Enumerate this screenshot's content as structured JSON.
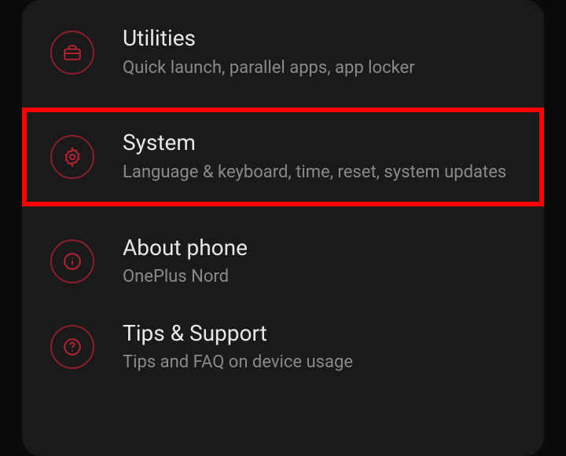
{
  "items": [
    {
      "icon": "toolbox-icon",
      "title": "Utilities",
      "subtitle": "Quick launch, parallel apps, app locker",
      "highlighted": false
    },
    {
      "icon": "gear-icon",
      "title": "System",
      "subtitle": "Language & keyboard, time, reset, system updates",
      "highlighted": true
    },
    {
      "icon": "info-icon",
      "title": "About phone",
      "subtitle": "OnePlus Nord",
      "highlighted": false
    },
    {
      "icon": "help-icon",
      "title": "Tips & Support",
      "subtitle": "Tips and FAQ on device usage",
      "highlighted": false
    }
  ]
}
